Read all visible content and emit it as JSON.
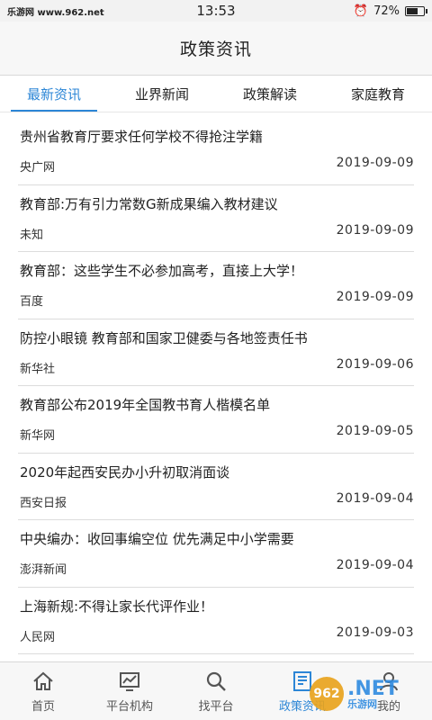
{
  "status_bar": {
    "site": "乐游网 www.962.net",
    "time": "13:53",
    "battery_percent": "72%",
    "battery_level": 0.72
  },
  "header": {
    "title": "政策资讯"
  },
  "tabs": [
    {
      "label": "最新资讯",
      "active": true
    },
    {
      "label": "业界新闻",
      "active": false
    },
    {
      "label": "政策解读",
      "active": false
    },
    {
      "label": "家庭教育",
      "active": false
    }
  ],
  "news": [
    {
      "title": "贵州省教育厅要求任何学校不得抢注学籍",
      "source": "央广网",
      "date": "2019-09-09"
    },
    {
      "title": "教育部:万有引力常数G新成果编入教材建议",
      "source": "未知",
      "date": "2019-09-09"
    },
    {
      "title": "教育部：这些学生不必参加高考，直接上大学！",
      "source": "百度",
      "date": "2019-09-09"
    },
    {
      "title": "防控小眼镜 教育部和国家卫健委与各地签责任书",
      "source": "新华社",
      "date": "2019-09-06"
    },
    {
      "title": "教育部公布2019年全国教书育人楷模名单",
      "source": "新华网",
      "date": "2019-09-05"
    },
    {
      "title": "2020年起西安民办小升初取消面谈",
      "source": "西安日报",
      "date": "2019-09-04"
    },
    {
      "title": "中央编办：收回事编空位 优先满足中小学需要",
      "source": "澎湃新闻",
      "date": "2019-09-04"
    },
    {
      "title": "上海新规:不得让家长代评作业！",
      "source": "人民网",
      "date": "2019-09-03"
    }
  ],
  "bottom_nav": [
    {
      "label": "首页",
      "icon": "home-icon"
    },
    {
      "label": "平台机构",
      "icon": "chart-icon"
    },
    {
      "label": "找平台",
      "icon": "search-icon"
    },
    {
      "label": "政策资讯",
      "icon": "news-icon"
    },
    {
      "label": "我的",
      "icon": "user-icon"
    }
  ],
  "watermark": {
    "circle": "962",
    "big": ".NET",
    "small": "乐游网"
  },
  "colors": {
    "accent": "#2c86d6",
    "watermark_orange": "#e9a21a"
  }
}
